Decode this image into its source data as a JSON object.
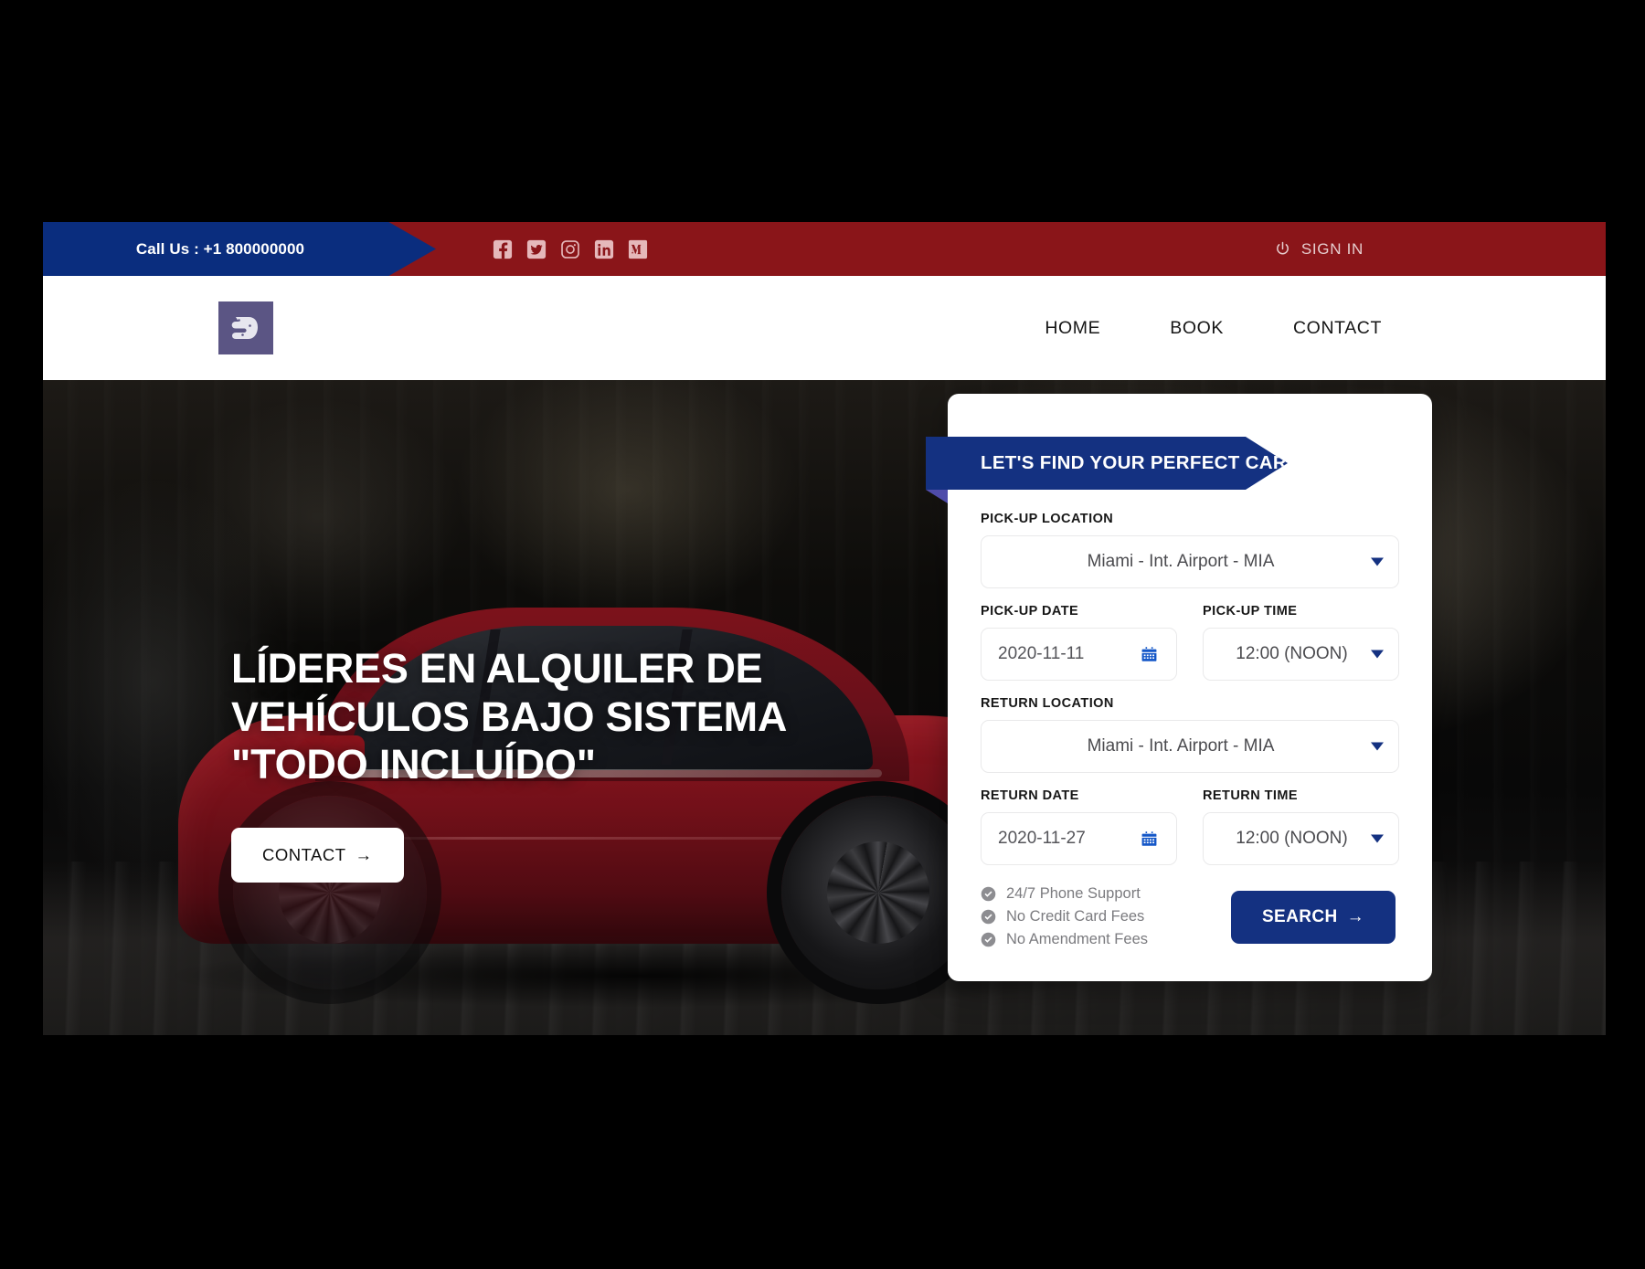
{
  "topbar": {
    "call_text": "Call Us : +1 800000000",
    "signin_label": "SIGN IN",
    "power_icon": "power-icon",
    "social": [
      {
        "name": "facebook-icon",
        "label": "Facebook"
      },
      {
        "name": "twitter-icon",
        "label": "Twitter"
      },
      {
        "name": "instagram-icon",
        "label": "Instagram"
      },
      {
        "name": "linkedin-icon",
        "label": "LinkedIn"
      },
      {
        "name": "medium-icon",
        "label": "Medium"
      }
    ],
    "blue": "#0a2d7e",
    "red": "#8a1519"
  },
  "nav": {
    "logo_alt": "site-logo",
    "links": [
      {
        "label": "HOME"
      },
      {
        "label": "BOOK"
      },
      {
        "label": "CONTACT"
      }
    ]
  },
  "hero": {
    "title": "LÍDERES EN ALQUILER DE VEHÍCULOS BAJO SISTEMA \"TODO INCLUÍDO\"",
    "contact_button": "CONTACT",
    "contact_arrow": "→"
  },
  "booking": {
    "banner": "LET'S FIND YOUR PERFECT CAR",
    "accent": "#143181",
    "fields": {
      "pickup_location_label": "PICK-UP LOCATION",
      "pickup_location_value": "Miami - Int. Airport - MIA",
      "pickup_date_label": "PICK-UP DATE",
      "pickup_date_value": "2020-11-11",
      "pickup_time_label": "PICK-UP TIME",
      "pickup_time_value": "12:00 (NOON)",
      "return_location_label": "RETURN LOCATION",
      "return_location_value": "Miami - Int. Airport - MIA",
      "return_date_label": "RETURN DATE",
      "return_date_value": "2020-11-27",
      "return_time_label": "RETURN TIME",
      "return_time_value": "12:00 (NOON)"
    },
    "perks": [
      {
        "text": "24/7 Phone Support"
      },
      {
        "text": "No Credit Card Fees"
      },
      {
        "text": "No Amendment Fees"
      }
    ],
    "search_button": "SEARCH",
    "search_arrow": "→"
  }
}
